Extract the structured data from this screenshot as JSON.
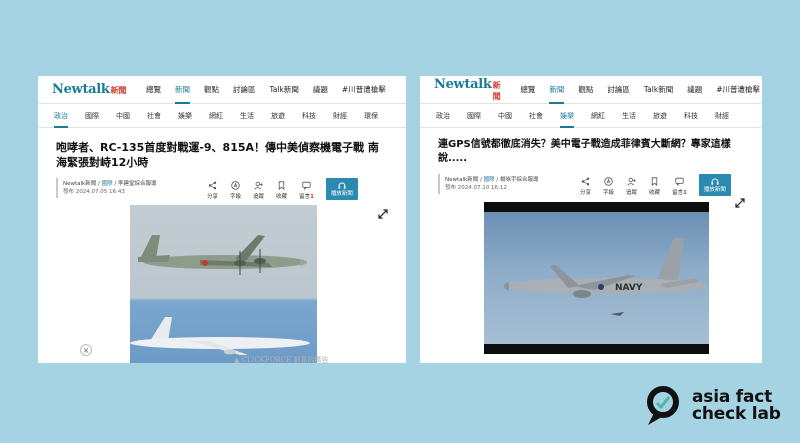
{
  "colors": {
    "background": "#a6d3e3",
    "accent": "#1a7a9a",
    "brand_red": "#d23b2d",
    "play_button": "#2a8ab0"
  },
  "left_panel": {
    "logo": {
      "text": "Newtalk",
      "suffix": "新聞"
    },
    "top_nav": [
      "總覽",
      "新聞",
      "觀點",
      "討論區",
      "Talk新聞",
      "議題",
      "#川普遭槍擊"
    ],
    "top_nav_active": "新聞",
    "sub_nav": [
      "政治",
      "國際",
      "中國",
      "社會",
      "娛樂",
      "網紅",
      "生活",
      "旅遊",
      "科技",
      "財經",
      "環保"
    ],
    "sub_nav_active": "政治",
    "headline": "咆哮者、RC-135首度對戰運-9、815A！傳中美偵察機電子戰 南海緊張對峙12小時",
    "byline": {
      "source": "Newtalk新聞",
      "sep": " / ",
      "category": "國際",
      "author": " / 李建堂綜合報導",
      "date": "發布 2024.07.05 16:43"
    },
    "actions": [
      {
        "icon": "share-icon",
        "label": "分享"
      },
      {
        "icon": "font-size-icon",
        "label": "字級"
      },
      {
        "icon": "follow-icon",
        "label": "追蹤"
      },
      {
        "icon": "bookmark-icon",
        "label": "收藏"
      },
      {
        "icon": "comment-icon",
        "label": "留言",
        "count": "1"
      }
    ],
    "play_button": "播放新聞",
    "close_label": "×",
    "ad_text": "▲ CLICKFORCE 創意的廣告"
  },
  "right_panel": {
    "logo": {
      "text": "Newtalk",
      "suffix": "新聞"
    },
    "top_nav": [
      "總覽",
      "新聞",
      "觀點",
      "討論區",
      "Talk新聞",
      "議題",
      "#川普遭槍擊"
    ],
    "top_nav_active": "新聞",
    "sub_nav": [
      "政治",
      "國際",
      "中國",
      "社會",
      "娛樂",
      "網紅",
      "生活",
      "旅遊",
      "科技",
      "財經"
    ],
    "sub_nav_active": "娛樂",
    "headline": "連GPS信號都徹底消失？美中電子戰造成菲律賓大斷網？專家這樣說.....",
    "byline": {
      "source": "Newtalk新聞",
      "sep": " / ",
      "category": "國際",
      "author": " / 楊咏宇綜合報導",
      "date": "發布 2024.07.10 16:12"
    },
    "actions": [
      {
        "icon": "share-icon",
        "label": "分享"
      },
      {
        "icon": "font-size-icon",
        "label": "字級"
      },
      {
        "icon": "follow-icon",
        "label": "追蹤"
      },
      {
        "icon": "bookmark-icon",
        "label": "收藏"
      },
      {
        "icon": "comment-icon",
        "label": "留言",
        "count": "1"
      }
    ],
    "play_button": "播放新聞",
    "plane_marking": "NAVY"
  },
  "brand": {
    "line1": "asia fact",
    "line2": "check lab"
  }
}
